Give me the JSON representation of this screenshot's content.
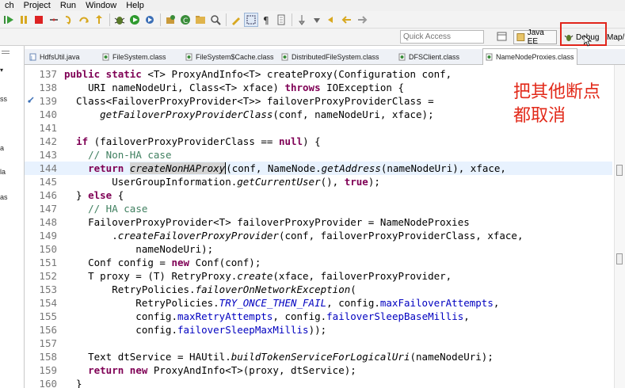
{
  "menubar": {
    "items": [
      "ch",
      "Project",
      "Run",
      "Window",
      "Help"
    ]
  },
  "quick_access": {
    "placeholder": "Quick Access"
  },
  "perspectives": {
    "java_ee": "Java EE",
    "debug": "Debug",
    "map": "Map/"
  },
  "left_panel": {
    "fragments": [
      "ss",
      "a",
      "la",
      "as"
    ]
  },
  "tabs": [
    {
      "label": "HdfsUtil.java"
    },
    {
      "label": "FileSystem.class"
    },
    {
      "label": "FileSystem$Cache.class"
    },
    {
      "label": "DistributedFileSystem.class"
    },
    {
      "label": "DFSClient.class"
    },
    {
      "label": "NameNodeProxies.class"
    }
  ],
  "annotation": {
    "line1": "把其他断点",
    "line2": "都取消"
  },
  "code": {
    "line_numbers": [
      "137",
      "138",
      "139",
      "140",
      "141",
      "142",
      "143",
      "144",
      "145",
      "146",
      "147",
      "148",
      "149",
      "150",
      "151",
      "152",
      "153",
      "154",
      "155",
      "156",
      "157",
      "158",
      "159",
      "160"
    ],
    "l137": {
      "kw1": "public static",
      "t1": " <T> ProxyAndInfo<T> createProxy(Configuration conf,"
    },
    "l138": {
      "t1": "    URI nameNodeUri, Class<T> xface) ",
      "kw1": "throws",
      "t2": " IOException {"
    },
    "l139": {
      "t1": "  Class<FailoverProxyProvider<T>> failoverProxyProviderClass ="
    },
    "l140": {
      "t1": "      ",
      "it1": "getFailoverProxyProviderClass",
      "t2": "(conf, nameNodeUri, xface);"
    },
    "l141": {
      "t1": ""
    },
    "l142": {
      "t1": "  ",
      "kw1": "if",
      "t2": " (failoverProxyProviderClass == ",
      "kw2": "null",
      "t3": ") {"
    },
    "l143": {
      "t1": "    ",
      "cm1": "// Non-HA case"
    },
    "l144": {
      "t1": "    ",
      "kw1": "return",
      "t2": " ",
      "it1": "createNonHAProxy",
      "t3": "(conf, NameNode.",
      "it2": "getAddress",
      "t4": "(nameNodeUri), xface,"
    },
    "l145": {
      "t1": "        UserGroupInformation.",
      "it1": "getCurrentUser",
      "t2": "(), ",
      "kw1": "true",
      "t3": ");"
    },
    "l146": {
      "t1": "  } ",
      "kw1": "else",
      "t2": " {"
    },
    "l147": {
      "t1": "    ",
      "cm1": "// HA case"
    },
    "l148": {
      "t1": "    FailoverProxyProvider<T> failoverProxyProvider = NameNodeProxies"
    },
    "l149": {
      "t1": "        .",
      "it1": "createFailoverProxyProvider",
      "t2": "(conf, failoverProxyProviderClass, xface,"
    },
    "l150": {
      "t1": "            nameNodeUri);"
    },
    "l151": {
      "t1": "    Conf config = ",
      "kw1": "new",
      "t2": " Conf(conf);"
    },
    "l152": {
      "t1": "    T proxy = (T) RetryProxy.",
      "it1": "create",
      "t2": "(xface, failoverProxyProvider,"
    },
    "l153": {
      "t1": "        RetryPolicies.",
      "it1": "failoverOnNetworkException",
      "t2": "("
    },
    "l154": {
      "t1": "            RetryPolicies.",
      "sf1": "TRY_ONCE_THEN_FAIL",
      "t2": ", config.",
      "f1": "maxFailoverAttempts",
      "t3": ","
    },
    "l155": {
      "t1": "            config.",
      "f1": "maxRetryAttempts",
      "t2": ", config.",
      "f2": "failoverSleepBaseMillis",
      "t3": ","
    },
    "l156": {
      "t1": "            config.",
      "f1": "failoverSleepMaxMillis",
      "t2": "));"
    },
    "l157": {
      "t1": ""
    },
    "l158": {
      "t1": "    Text dtService = HAUtil.",
      "it1": "buildTokenServiceForLogicalUri",
      "t2": "(nameNodeUri);"
    },
    "l159": {
      "t1": "    ",
      "kw1": "return",
      "t2": " ",
      "kw2": "new",
      "t3": " ProxyAndInfo<T>(proxy, dtService);"
    },
    "l160": {
      "t1": "  }"
    }
  },
  "colors": {
    "keyword": "#7f0055",
    "comment": "#3f7f5f",
    "field": "#0000c0",
    "annotation": "#e22a1a",
    "highlight_box": "#e1251b",
    "current_line": "#e8f2fe"
  },
  "icons": [
    "bug-debug-icon",
    "run-icon",
    "terminate-icon",
    "open-perspective-icon",
    "java-class-icon",
    "breakpoint-icon",
    "cursor-arrow-icon"
  ]
}
